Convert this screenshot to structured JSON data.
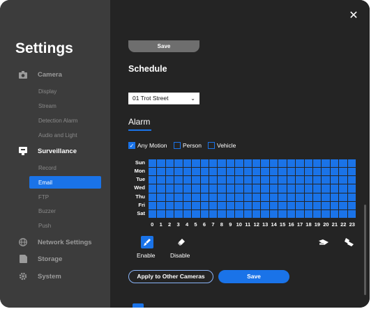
{
  "sidebar": {
    "title": "Settings",
    "camera": {
      "label": "Camera",
      "icon": "camera-icon",
      "items": [
        "Display",
        "Stream",
        "Detection Alarm",
        "Audio and Light"
      ]
    },
    "surveillance": {
      "label": "Surveillance",
      "icon": "monitor-icon",
      "items": [
        "Record",
        "Email",
        "FTP",
        "Buzzer",
        "Push"
      ],
      "active": "Email"
    },
    "network": {
      "label": "Network Settings",
      "icon": "globe-icon"
    },
    "storage": {
      "label": "Storage",
      "icon": "storage-icon"
    },
    "system": {
      "label": "System",
      "icon": "gear-icon"
    }
  },
  "main": {
    "top_save_label": "Save",
    "schedule_heading": "Schedule",
    "camera_select_value": "01  Trot Street",
    "alarm_heading": "Alarm",
    "filters": [
      {
        "label": "Any Motion",
        "checked": true
      },
      {
        "label": "Person",
        "checked": false
      },
      {
        "label": "Vehicle",
        "checked": false
      }
    ],
    "days": [
      "Sun",
      "Mon",
      "Tue",
      "Wed",
      "Thu",
      "Fri",
      "Sat"
    ],
    "hours": [
      "0",
      "1",
      "2",
      "3",
      "4",
      "5",
      "6",
      "7",
      "8",
      "9",
      "10",
      "11",
      "12",
      "13",
      "14",
      "15",
      "16",
      "17",
      "18",
      "19",
      "20",
      "21",
      "22",
      "23"
    ],
    "tools": {
      "enable_label": "Enable",
      "disable_label": "Disable"
    },
    "apply_label": "Apply to Other Cameras",
    "save_label": "Save"
  },
  "colors": {
    "accent": "#1a73e8",
    "sidebar_bg": "#3c3c3c",
    "main_bg": "#242424"
  }
}
